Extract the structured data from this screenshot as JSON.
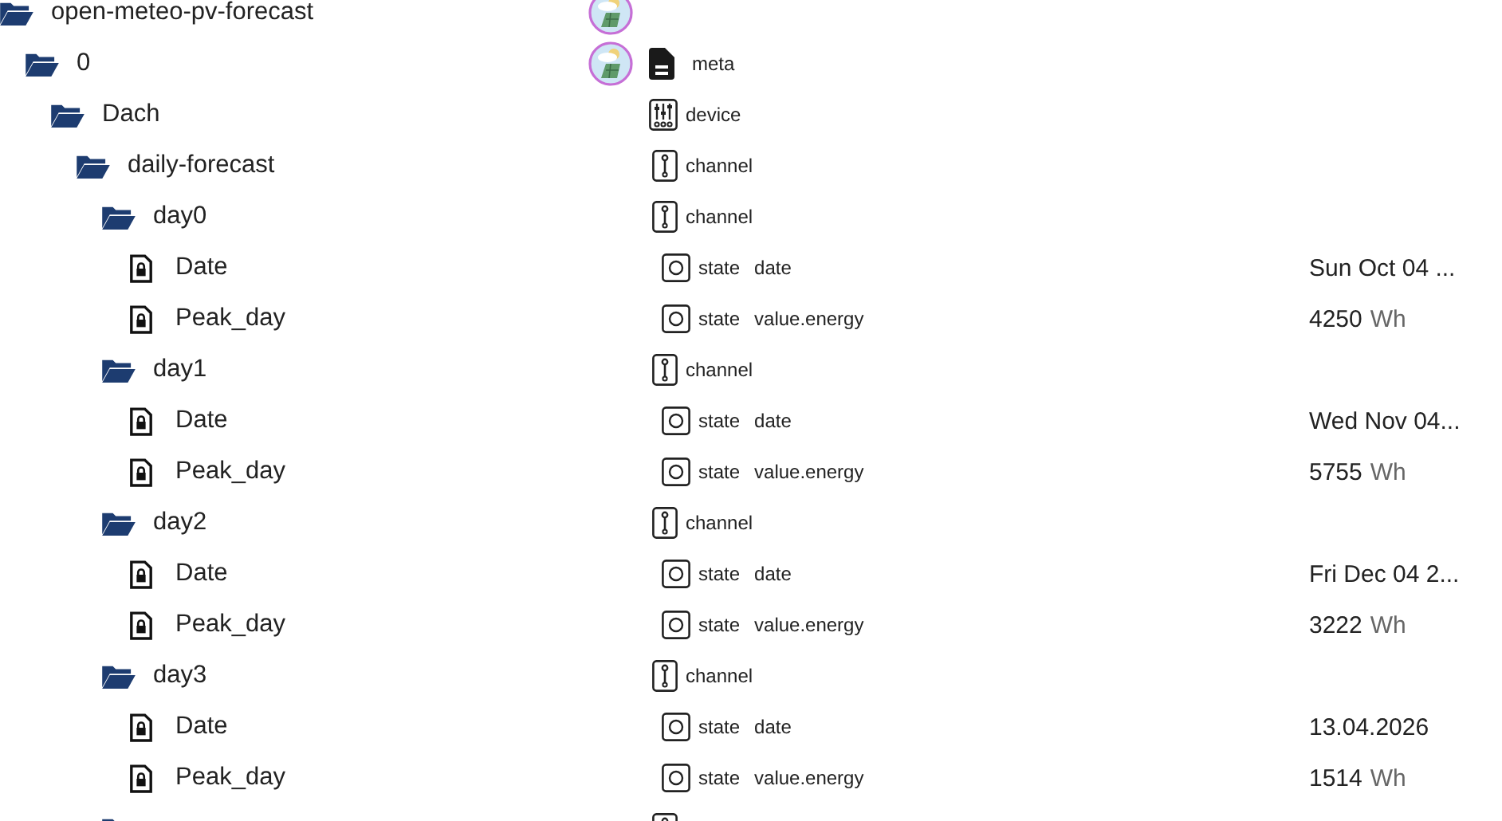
{
  "tree": [
    {
      "kind": "root",
      "name": "open-meteo-pv-forecast",
      "avatar": true,
      "children": [
        {
          "kind": "meta",
          "name": "0",
          "avatar": true,
          "type": "meta",
          "children": [
            {
              "kind": "device",
              "name": "Dach",
              "type": "device",
              "children": [
                {
                  "kind": "channel",
                  "name": "daily-forecast",
                  "type": "channel",
                  "children": [
                    {
                      "kind": "channel",
                      "name": "day0",
                      "type": "channel",
                      "children": [
                        {
                          "kind": "state",
                          "name": "Date",
                          "type": "state",
                          "role": "date",
                          "value": "Sun Oct 04 ..."
                        },
                        {
                          "kind": "state",
                          "name": "Peak_day",
                          "type": "state",
                          "role": "value.energy",
                          "value": "4250",
                          "unit": "Wh"
                        }
                      ]
                    },
                    {
                      "kind": "channel",
                      "name": "day1",
                      "type": "channel",
                      "children": [
                        {
                          "kind": "state",
                          "name": "Date",
                          "type": "state",
                          "role": "date",
                          "value": "Wed Nov 04..."
                        },
                        {
                          "kind": "state",
                          "name": "Peak_day",
                          "type": "state",
                          "role": "value.energy",
                          "value": "5755",
                          "unit": "Wh"
                        }
                      ]
                    },
                    {
                      "kind": "channel",
                      "name": "day2",
                      "type": "channel",
                      "children": [
                        {
                          "kind": "state",
                          "name": "Date",
                          "type": "state",
                          "role": "date",
                          "value": "Fri Dec 04 2..."
                        },
                        {
                          "kind": "state",
                          "name": "Peak_day",
                          "type": "state",
                          "role": "value.energy",
                          "value": "3222",
                          "unit": "Wh"
                        }
                      ]
                    },
                    {
                      "kind": "channel",
                      "name": "day3",
                      "type": "channel",
                      "children": [
                        {
                          "kind": "state",
                          "name": "Date",
                          "type": "state",
                          "role": "date",
                          "value": "13.04.2026"
                        },
                        {
                          "kind": "state",
                          "name": "Peak_day",
                          "type": "state",
                          "role": "value.energy",
                          "value": "1514",
                          "unit": "Wh"
                        }
                      ]
                    },
                    {
                      "kind": "channel"
                    }
                  ]
                }
              ]
            }
          ]
        }
      ]
    }
  ]
}
